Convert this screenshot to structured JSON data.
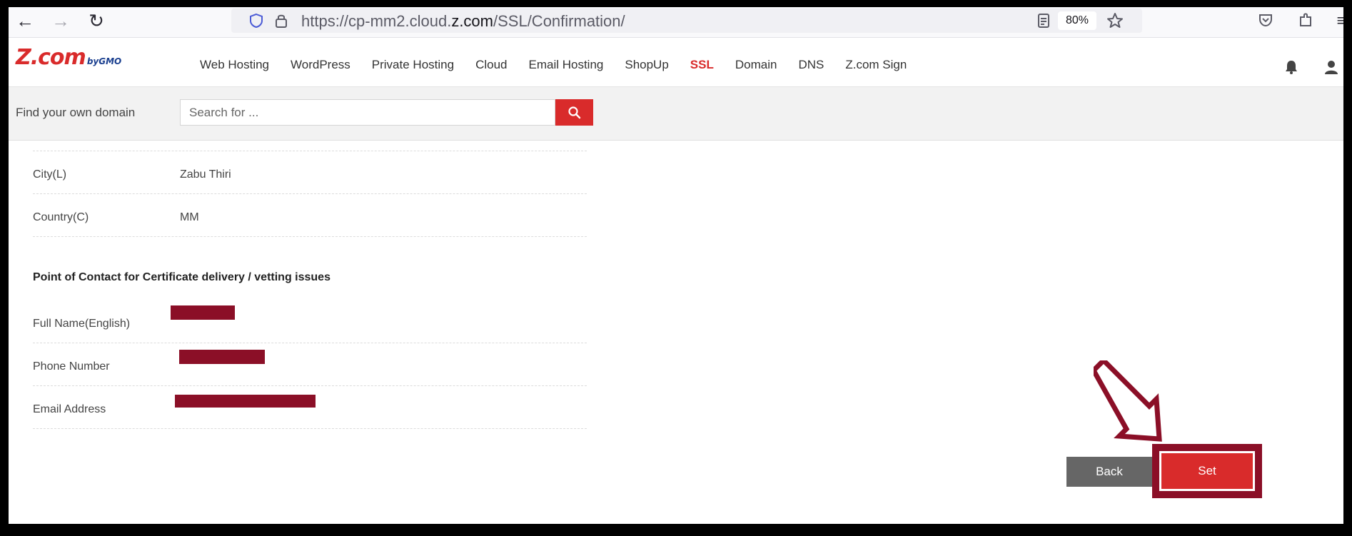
{
  "browser": {
    "url_prefix": "https://cp-mm2.cloud.",
    "url_domain": "z.com",
    "url_path": "/SSL/Confirmation/",
    "zoom": "80%"
  },
  "site": {
    "logo_main": "Z.com",
    "logo_sub": "byGMO",
    "nav": [
      {
        "label": "Web Hosting"
      },
      {
        "label": "WordPress"
      },
      {
        "label": "Private Hosting"
      },
      {
        "label": "Cloud"
      },
      {
        "label": "Email Hosting"
      },
      {
        "label": "ShopUp"
      },
      {
        "label": "SSL",
        "active": true
      },
      {
        "label": "Domain"
      },
      {
        "label": "DNS"
      },
      {
        "label": "Z.com Sign"
      }
    ]
  },
  "domain_search": {
    "label": "Find your own domain",
    "placeholder": "Search for ..."
  },
  "details": {
    "city_label": "City(L)",
    "city_value": "Zabu Thiri",
    "country_label": "Country(C)",
    "country_value": "MM"
  },
  "contact": {
    "title": "Point of Contact for Certificate delivery / vetting issues",
    "full_name_label": "Full Name(English)",
    "phone_label": "Phone Number",
    "email_label": "Email Address"
  },
  "actions": {
    "back_label": "Back",
    "set_label": "Set"
  },
  "colors": {
    "brand_red": "#d92b2b",
    "annotation_maroon": "#8b0f27"
  }
}
